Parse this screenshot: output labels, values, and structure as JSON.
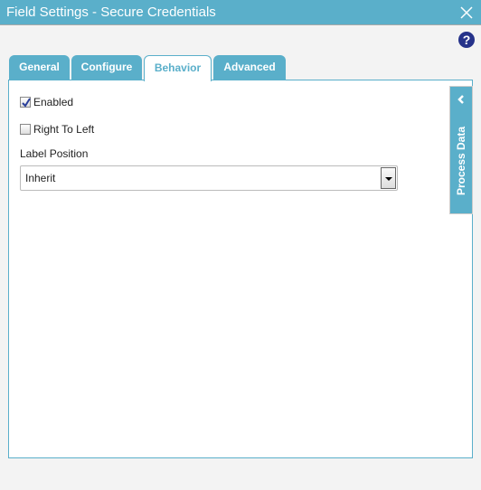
{
  "window": {
    "title": "Field Settings - Secure Credentials",
    "accent": "#5aafca"
  },
  "help": {
    "glyph": "?"
  },
  "tabs": [
    {
      "label": "General"
    },
    {
      "label": "Configure"
    },
    {
      "label": "Behavior",
      "active": true
    },
    {
      "label": "Advanced"
    }
  ],
  "form": {
    "enabled": {
      "label": "Enabled",
      "checked": true
    },
    "rtl": {
      "label": "Right To Left",
      "checked": false
    },
    "label_position": {
      "label": "Label Position",
      "value": "Inherit"
    }
  },
  "side_panel": {
    "label": "Process Data"
  }
}
